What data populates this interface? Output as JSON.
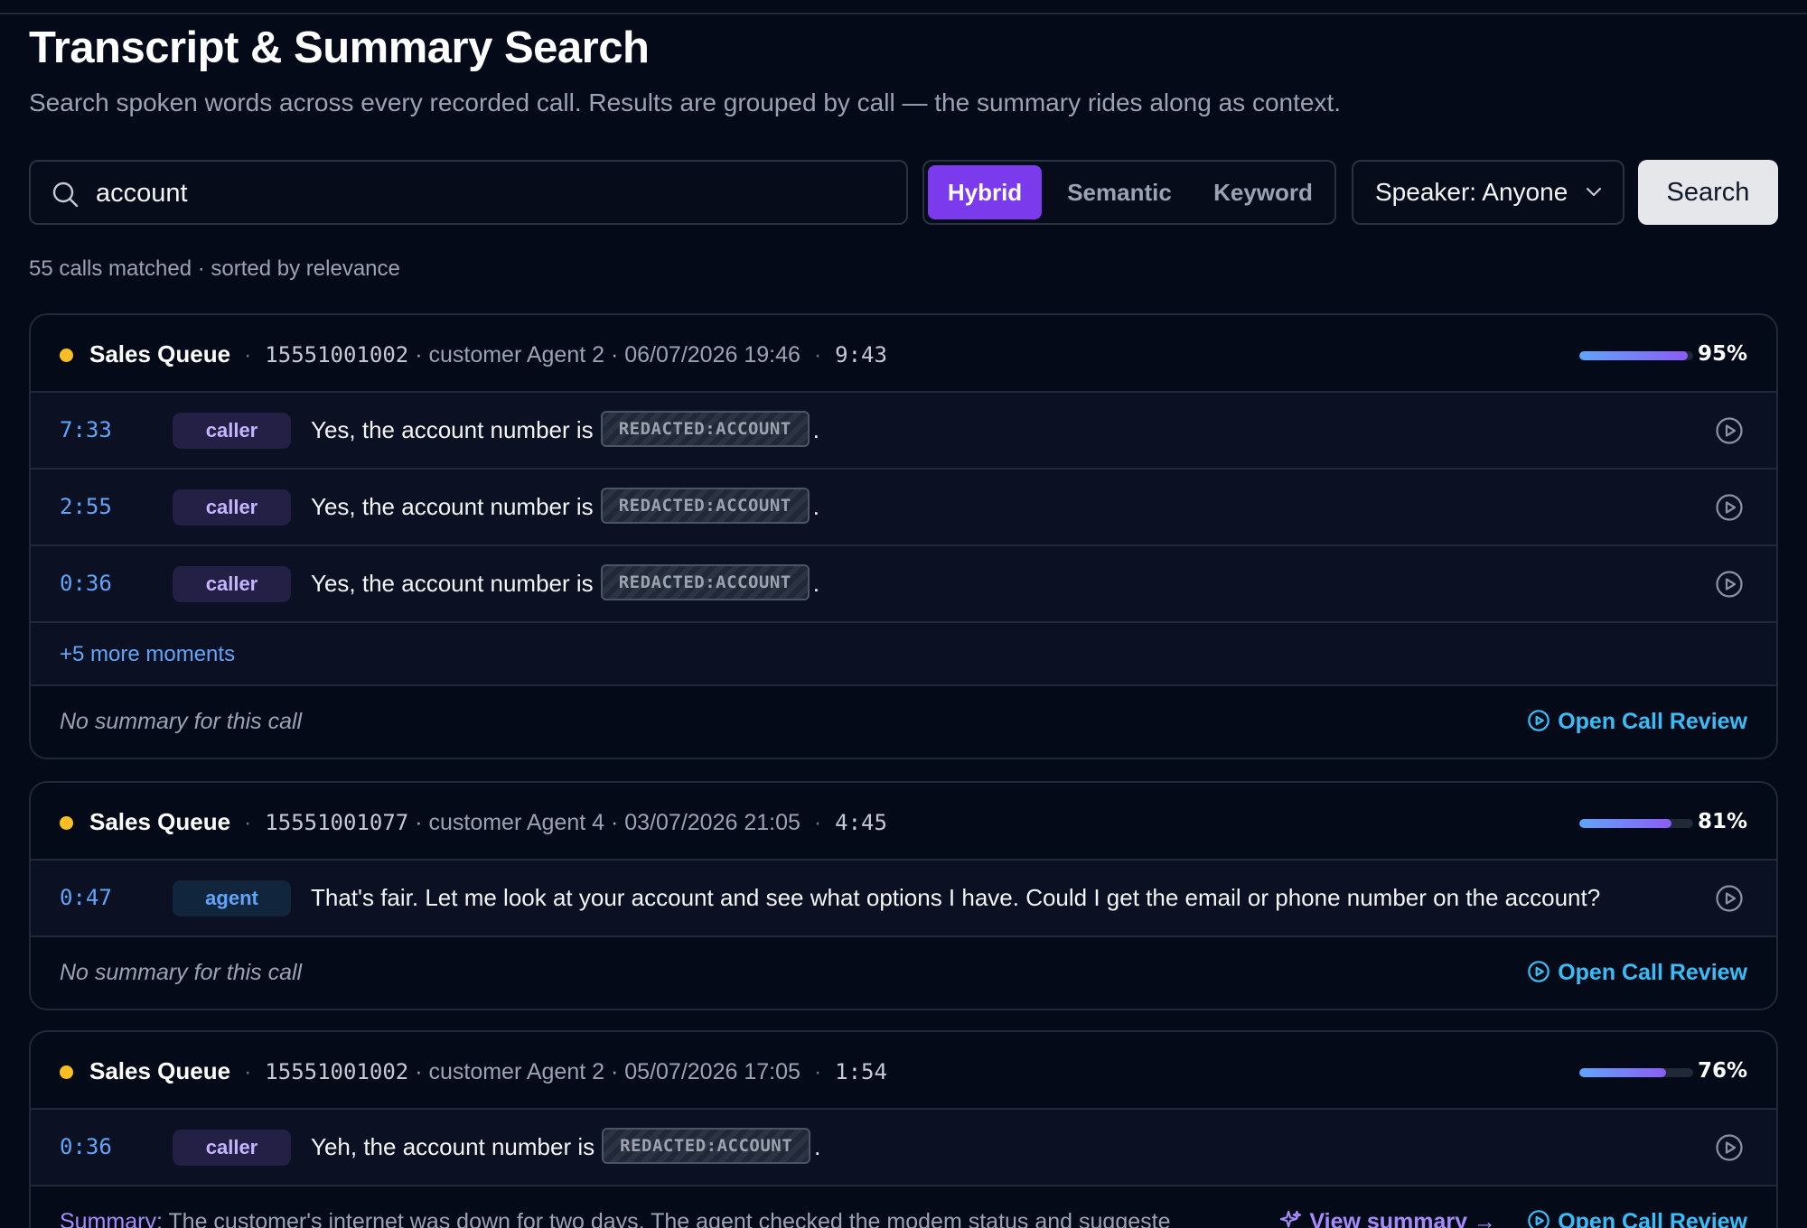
{
  "page": {
    "title": "Transcript & Summary Search",
    "subtitle": "Search spoken words across every recorded call. Results are grouped by call — the summary rides along as context."
  },
  "search": {
    "query": "account",
    "modes": [
      "Hybrid",
      "Semantic",
      "Keyword"
    ],
    "active_mode": "Hybrid",
    "speaker_filter": "Speaker: Anyone",
    "button_label": "Search"
  },
  "results_meta": "55 calls matched · sorted by relevance",
  "colors": {
    "accent": "#7c3aed",
    "link": "#60a5fa",
    "status_dot": "#fbbf24",
    "summary": "#a78bfa",
    "review": "#38bdf8"
  },
  "cards": [
    {
      "queue": "Sales Queue",
      "phone": "15551001002",
      "agent": "· customer Agent 2 ·",
      "datetime": "06/07/2026 19:46",
      "duration": "9:43",
      "score": 0.95,
      "score_label": "95%",
      "moments": [
        {
          "ts": "7:33",
          "role": "caller",
          "text": "Yes, the account number is",
          "redacted": "REDACTED:ACCOUNT",
          "after": "."
        },
        {
          "ts": "2:55",
          "role": "caller",
          "text": "Yes, the account number is",
          "redacted": "REDACTED:ACCOUNT",
          "after": "."
        },
        {
          "ts": "0:36",
          "role": "caller",
          "text": "Yes, the account number is",
          "redacted": "REDACTED:ACCOUNT",
          "after": "."
        }
      ],
      "more_label": "+5 more moments",
      "summary_text": "No summary for this call",
      "open_review": "Open Call Review"
    },
    {
      "queue": "Sales Queue",
      "phone": "15551001077",
      "agent": "· customer Agent 4 ·",
      "datetime": "03/07/2026 21:05",
      "duration": "4:45",
      "score": 0.81,
      "score_label": "81%",
      "moments": [
        {
          "ts": "0:47",
          "role": "agent",
          "text": "That's fair. Let me look at your account and see what options I have. Could I get the email or phone number on the account?"
        }
      ],
      "summary_text": "No summary for this call",
      "open_review": "Open Call Review"
    },
    {
      "queue": "Sales Queue",
      "phone": "15551001002",
      "agent": "· customer Agent 2 ·",
      "datetime": "05/07/2026 17:05",
      "duration": "1:54",
      "score": 0.76,
      "score_label": "76%",
      "moments": [
        {
          "ts": "0:36",
          "role": "caller",
          "text": "Yeh, the account number is",
          "redacted": "REDACTED:ACCOUNT",
          "after": "."
        }
      ],
      "summary_label": "Summary:",
      "summary_body": " The customer's internet was down for two days. The agent checked the modem status and suggeste",
      "view_summary": "View summary →",
      "open_review": "Open Call Review"
    }
  ]
}
